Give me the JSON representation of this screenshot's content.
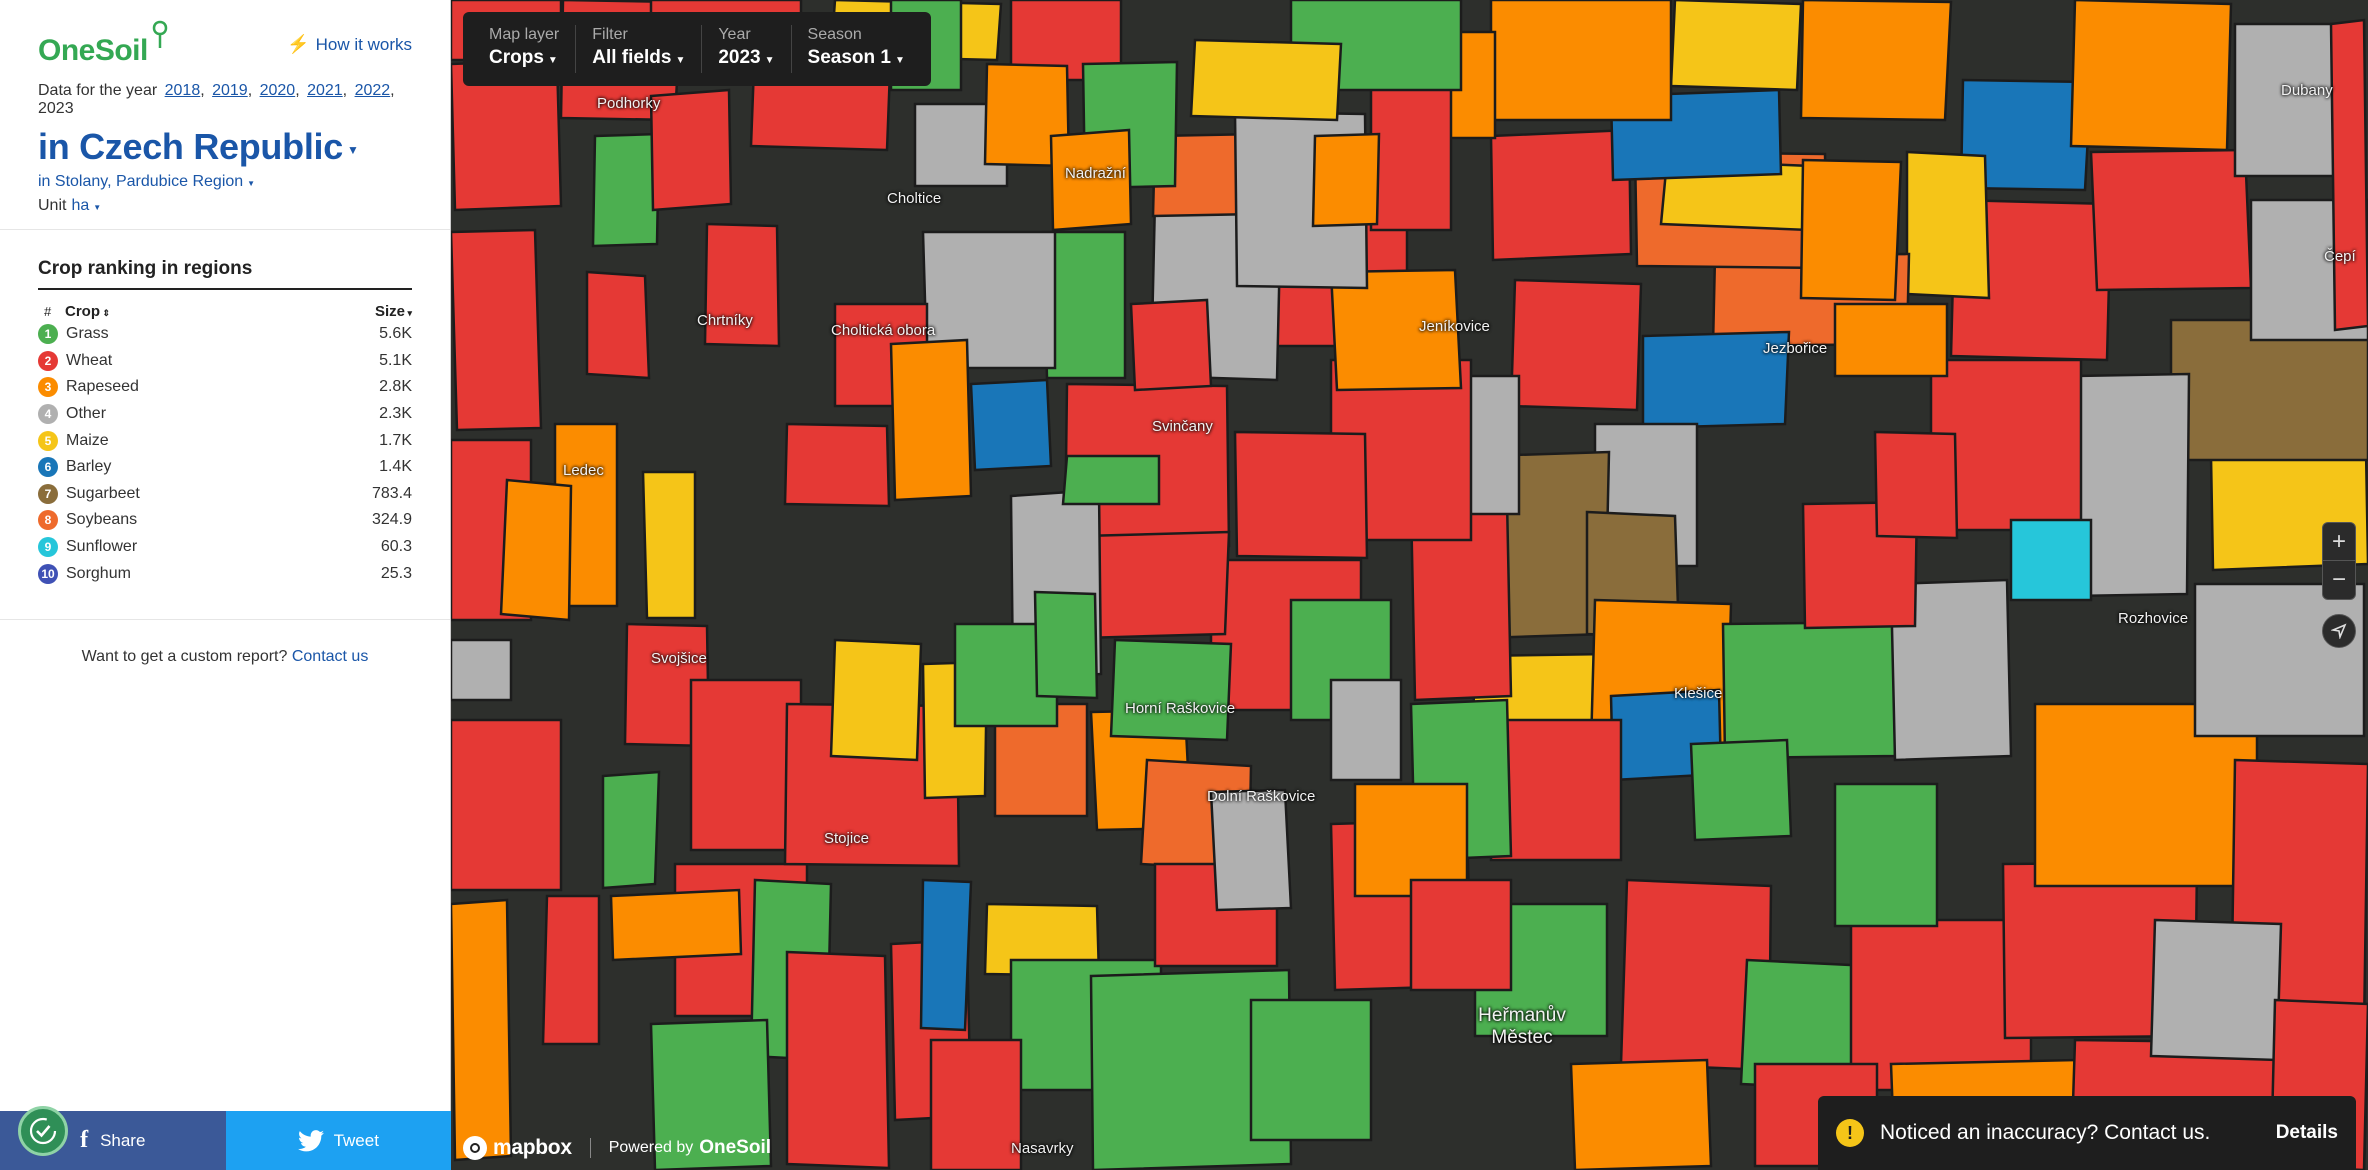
{
  "sidebar": {
    "logo_text": "OneSoil",
    "how_it_works": "How it works",
    "year_prefix": "Data for the year",
    "years": [
      "2018",
      "2019",
      "2020",
      "2021",
      "2022"
    ],
    "current_year": "2023",
    "country": "in Czech Republic",
    "region": "in Stolany, Pardubice Region",
    "unit_label": "Unit",
    "unit_value": "ha",
    "ranking_title": "Crop ranking in regions",
    "col_hash": "#",
    "col_crop": "Crop",
    "col_size": "Size",
    "crops": [
      {
        "rank": "1",
        "name": "Grass",
        "size": "5.6K",
        "color": "#4caf50"
      },
      {
        "rank": "2",
        "name": "Wheat",
        "size": "5.1K",
        "color": "#e53935"
      },
      {
        "rank": "3",
        "name": "Rapeseed",
        "size": "2.8K",
        "color": "#fb8c00"
      },
      {
        "rank": "4",
        "name": "Other",
        "size": "2.3K",
        "color": "#b0b0b0"
      },
      {
        "rank": "5",
        "name": "Maize",
        "size": "1.7K",
        "color": "#f5c518"
      },
      {
        "rank": "6",
        "name": "Barley",
        "size": "1.4K",
        "color": "#1976b8"
      },
      {
        "rank": "7",
        "name": "Sugarbeet",
        "size": "783.4",
        "color": "#8a6d3b"
      },
      {
        "rank": "8",
        "name": "Soybeans",
        "size": "324.9",
        "color": "#ee6a2c"
      },
      {
        "rank": "9",
        "name": "Sunflower",
        "size": "60.3",
        "color": "#26c6da"
      },
      {
        "rank": "10",
        "name": "Sorghum",
        "size": "25.3",
        "color": "#3f51b5"
      }
    ],
    "custom_report_text": "Want to get a custom report?",
    "contact_link": "Contact us",
    "share_label": "Share",
    "tweet_label": "Tweet"
  },
  "map_controls": {
    "layer_label": "Map layer",
    "layer_value": "Crops",
    "filter_label": "Filter",
    "filter_value": "All fields",
    "year_label": "Year",
    "year_value": "2023",
    "season_label": "Season",
    "season_value": "Season 1"
  },
  "places": [
    {
      "name": "Podhorky"
    },
    {
      "name": "Nadražní"
    },
    {
      "name": "Choltice"
    },
    {
      "name": "Chrtníky"
    },
    {
      "name": "Choltická obora"
    },
    {
      "name": "Svinčany"
    },
    {
      "name": "Jeníkovice"
    },
    {
      "name": "Jezbořice"
    },
    {
      "name": "Dubany"
    },
    {
      "name": "Čepí"
    },
    {
      "name": "Ledec"
    },
    {
      "name": "Svojšice"
    },
    {
      "name": "Horní Raškovice"
    },
    {
      "name": "Dolní Raškovice"
    },
    {
      "name": "Klešice"
    },
    {
      "name": "Rozhovice"
    },
    {
      "name": "Stojice"
    },
    {
      "name": "Heřmanův Městec"
    },
    {
      "name": "Nasavrky"
    }
  ],
  "attribution": {
    "mapbox": "mapbox",
    "powered_by": "Powered by",
    "onesoil": "OneSoil"
  },
  "notice": {
    "message": "Noticed an inaccuracy? Contact us.",
    "details": "Details"
  },
  "colors": {
    "brand_blue": "#1a56a8",
    "brand_green": "#34a853",
    "facebook": "#3b5998",
    "twitter": "#1da1f2"
  }
}
